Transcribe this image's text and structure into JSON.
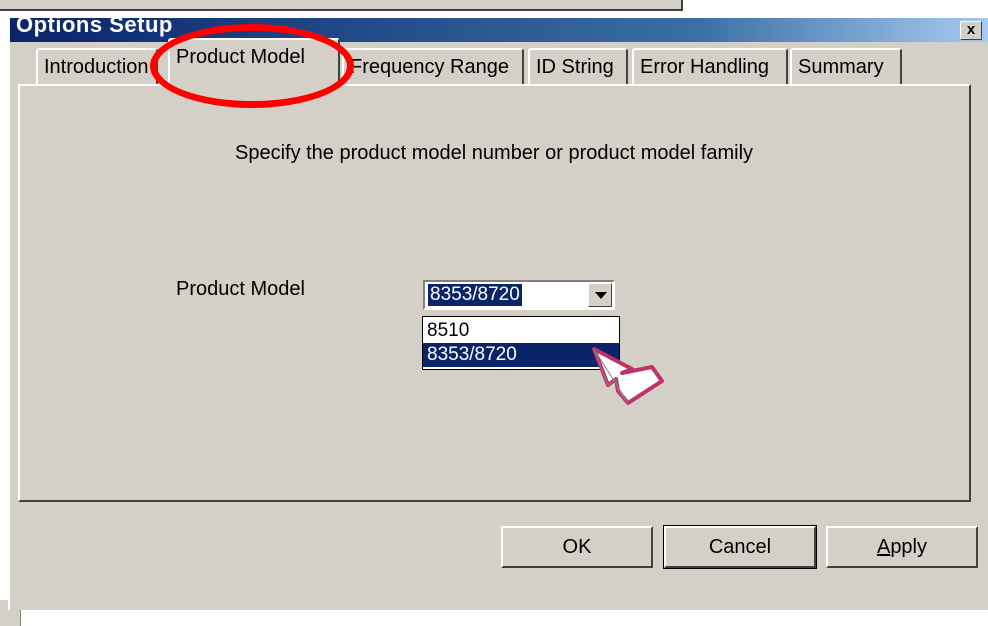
{
  "dialog": {
    "title": "Options Setup",
    "close_label": "x"
  },
  "tabs": [
    {
      "label": "Introduction",
      "active": false
    },
    {
      "label": "Product Model",
      "active": true
    },
    {
      "label": "Frequency Range",
      "active": false
    },
    {
      "label": "ID String",
      "active": false
    },
    {
      "label": "Error Handling",
      "active": false
    },
    {
      "label": "Summary",
      "active": false
    }
  ],
  "panel": {
    "instruction": "Specify the product model number or product model family",
    "product_model_label": "Product Model",
    "product_model_value": "8353/8720",
    "product_model_options": [
      {
        "label": "8510",
        "selected": false
      },
      {
        "label": "8353/8720",
        "selected": true
      }
    ]
  },
  "buttons": {
    "ok": "OK",
    "cancel": "Cancel",
    "apply": "Apply"
  },
  "annotations": {
    "highlight_color": "#ff0000",
    "cursor_color": "#c0306a",
    "cursor_icon": "hand-pointer-arrow-icon"
  },
  "colors": {
    "dialog_face": "#d4d0c8",
    "selection": "#0a246a",
    "titlebar": "#0a246a"
  }
}
